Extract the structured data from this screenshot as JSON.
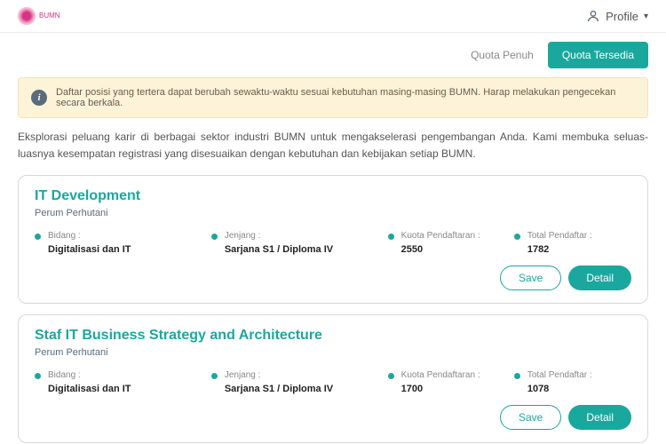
{
  "header": {
    "profile_label": "Profile"
  },
  "tabs": {
    "full": "Quota Penuh",
    "available": "Quota Tersedia"
  },
  "alert": {
    "text": "Daftar posisi yang tertera dapat berubah sewaktu-waktu sesuai kebutuhan masing-masing BUMN. Harap melakukan pengecekan secara berkala."
  },
  "intro": "Eksplorasi peluang karir di berbagai sektor industri BUMN untuk mengakselerasi pengembangan Anda. Kami membuka seluas-luasnya kesempatan registrasi yang disesuaikan dengan kebutuhan dan kebijakan setiap BUMN.",
  "labels": {
    "bidang": "Bidang :",
    "jenjang": "Jenjang :",
    "kuota": "Kuota Pendaftaran :",
    "total": "Total Pendaftar :"
  },
  "buttons": {
    "save": "Save",
    "detail": "Detail"
  },
  "cards": [
    {
      "title": "IT Development",
      "company": "Perum Perhutani",
      "bidang": "Digitalisasi dan IT",
      "jenjang": "Sarjana S1 / Diploma IV",
      "kuota": "2550",
      "total": "1782"
    },
    {
      "title": "Staf IT Business Strategy and Architecture",
      "company": "Perum Perhutani",
      "bidang": "Digitalisasi dan IT",
      "jenjang": "Sarjana S1 / Diploma IV",
      "kuota": "1700",
      "total": "1078"
    }
  ]
}
